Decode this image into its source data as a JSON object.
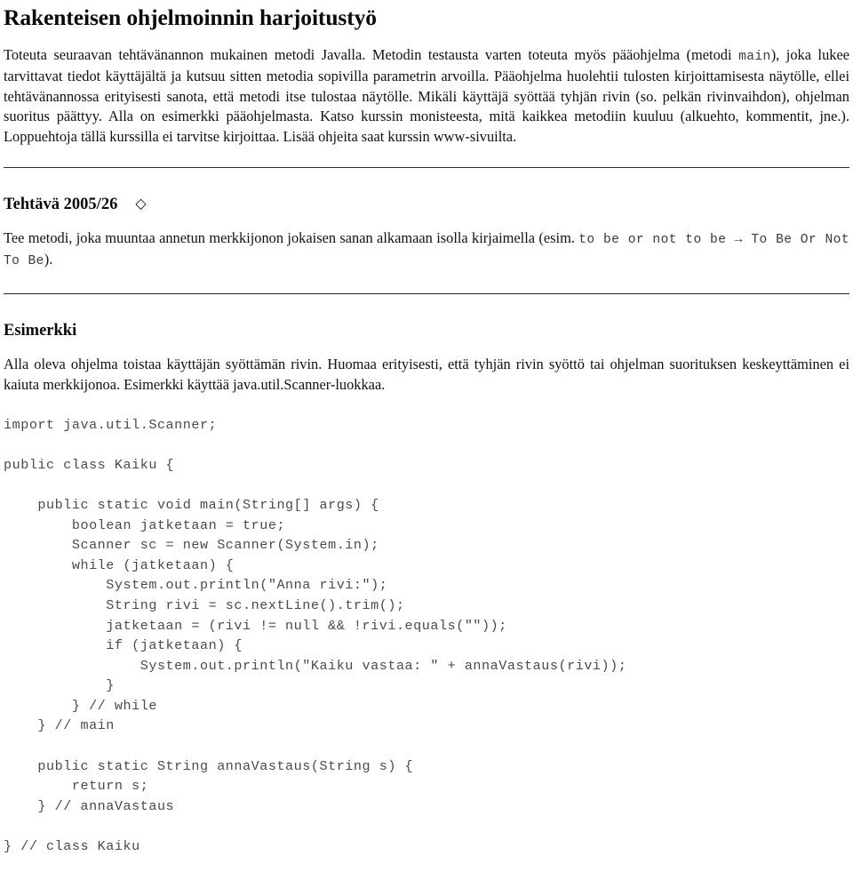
{
  "document": {
    "title": "Rakenteisen ohjelmoinnin harjoitustyö",
    "intro": {
      "part1": "Toteuta seuraavan tehtävänannon mukainen metodi Javalla. Metodin testausta varten toteuta myös pääohjelma (metodi ",
      "code1": "main",
      "part2": "), joka lukee tarvittavat tiedot käyttäjältä ja kutsuu sitten metodia sopivilla parametrin arvoilla. Pääohjelma huolehtii tulosten kirjoittamisesta näytölle, ellei tehtävänannossa erityisesti sanota, että metodi itse tulostaa näytölle. Mikäli käyttäjä syöttää tyhjän rivin (so. pelkän rivinvaihdon), ohjelman suoritus päättyy. Alla on esimerkki pääohjelmasta. Katso kurssin monisteesta, mitä kaikkea metodiin kuuluu (alkuehto, kommentit, jne.). Loppuehtoja tällä kurssilla ei tarvitse kirjoittaa. Lisää ohjeita saat kurssin www-sivuilta."
    },
    "assignment": {
      "heading": "Tehtävä 2005/26",
      "difficulty_marker": "◇",
      "text_part1": "Tee metodi, joka muuntaa annetun merkkijonon jokaisen sanan alkamaan isolla kirjaimella (esim. ",
      "code_example_input": "to be or not to be",
      "arrow": " → ",
      "code_example_output": "To Be Or Not To Be",
      "text_part2": ")."
    },
    "example": {
      "heading": "Esimerkki",
      "text": "Alla oleva ohjelma toistaa käyttäjän syöttämän rivin. Huomaa erityisesti, että tyhjän rivin syöttö tai ohjelman suorituksen keskeyttäminen ei kaiuta merkkijonoa. Esimerkki käyttää java.util.Scanner-luokkaa.",
      "code": "import java.util.Scanner;\n\npublic class Kaiku {\n\n    public static void main(String[] args) {\n        boolean jatketaan = true;\n        Scanner sc = new Scanner(System.in);\n        while (jatketaan) {\n            System.out.println(\"Anna rivi:\");\n            String rivi = sc.nextLine().trim();\n            jatketaan = (rivi != null && !rivi.equals(\"\"));\n            if (jatketaan) {\n                System.out.println(\"Kaiku vastaa: \" + annaVastaus(rivi));\n            }\n        } // while\n    } // main\n\n    public static String annaVastaus(String s) {\n        return s;\n    } // annaVastaus\n\n} // class Kaiku"
    }
  }
}
